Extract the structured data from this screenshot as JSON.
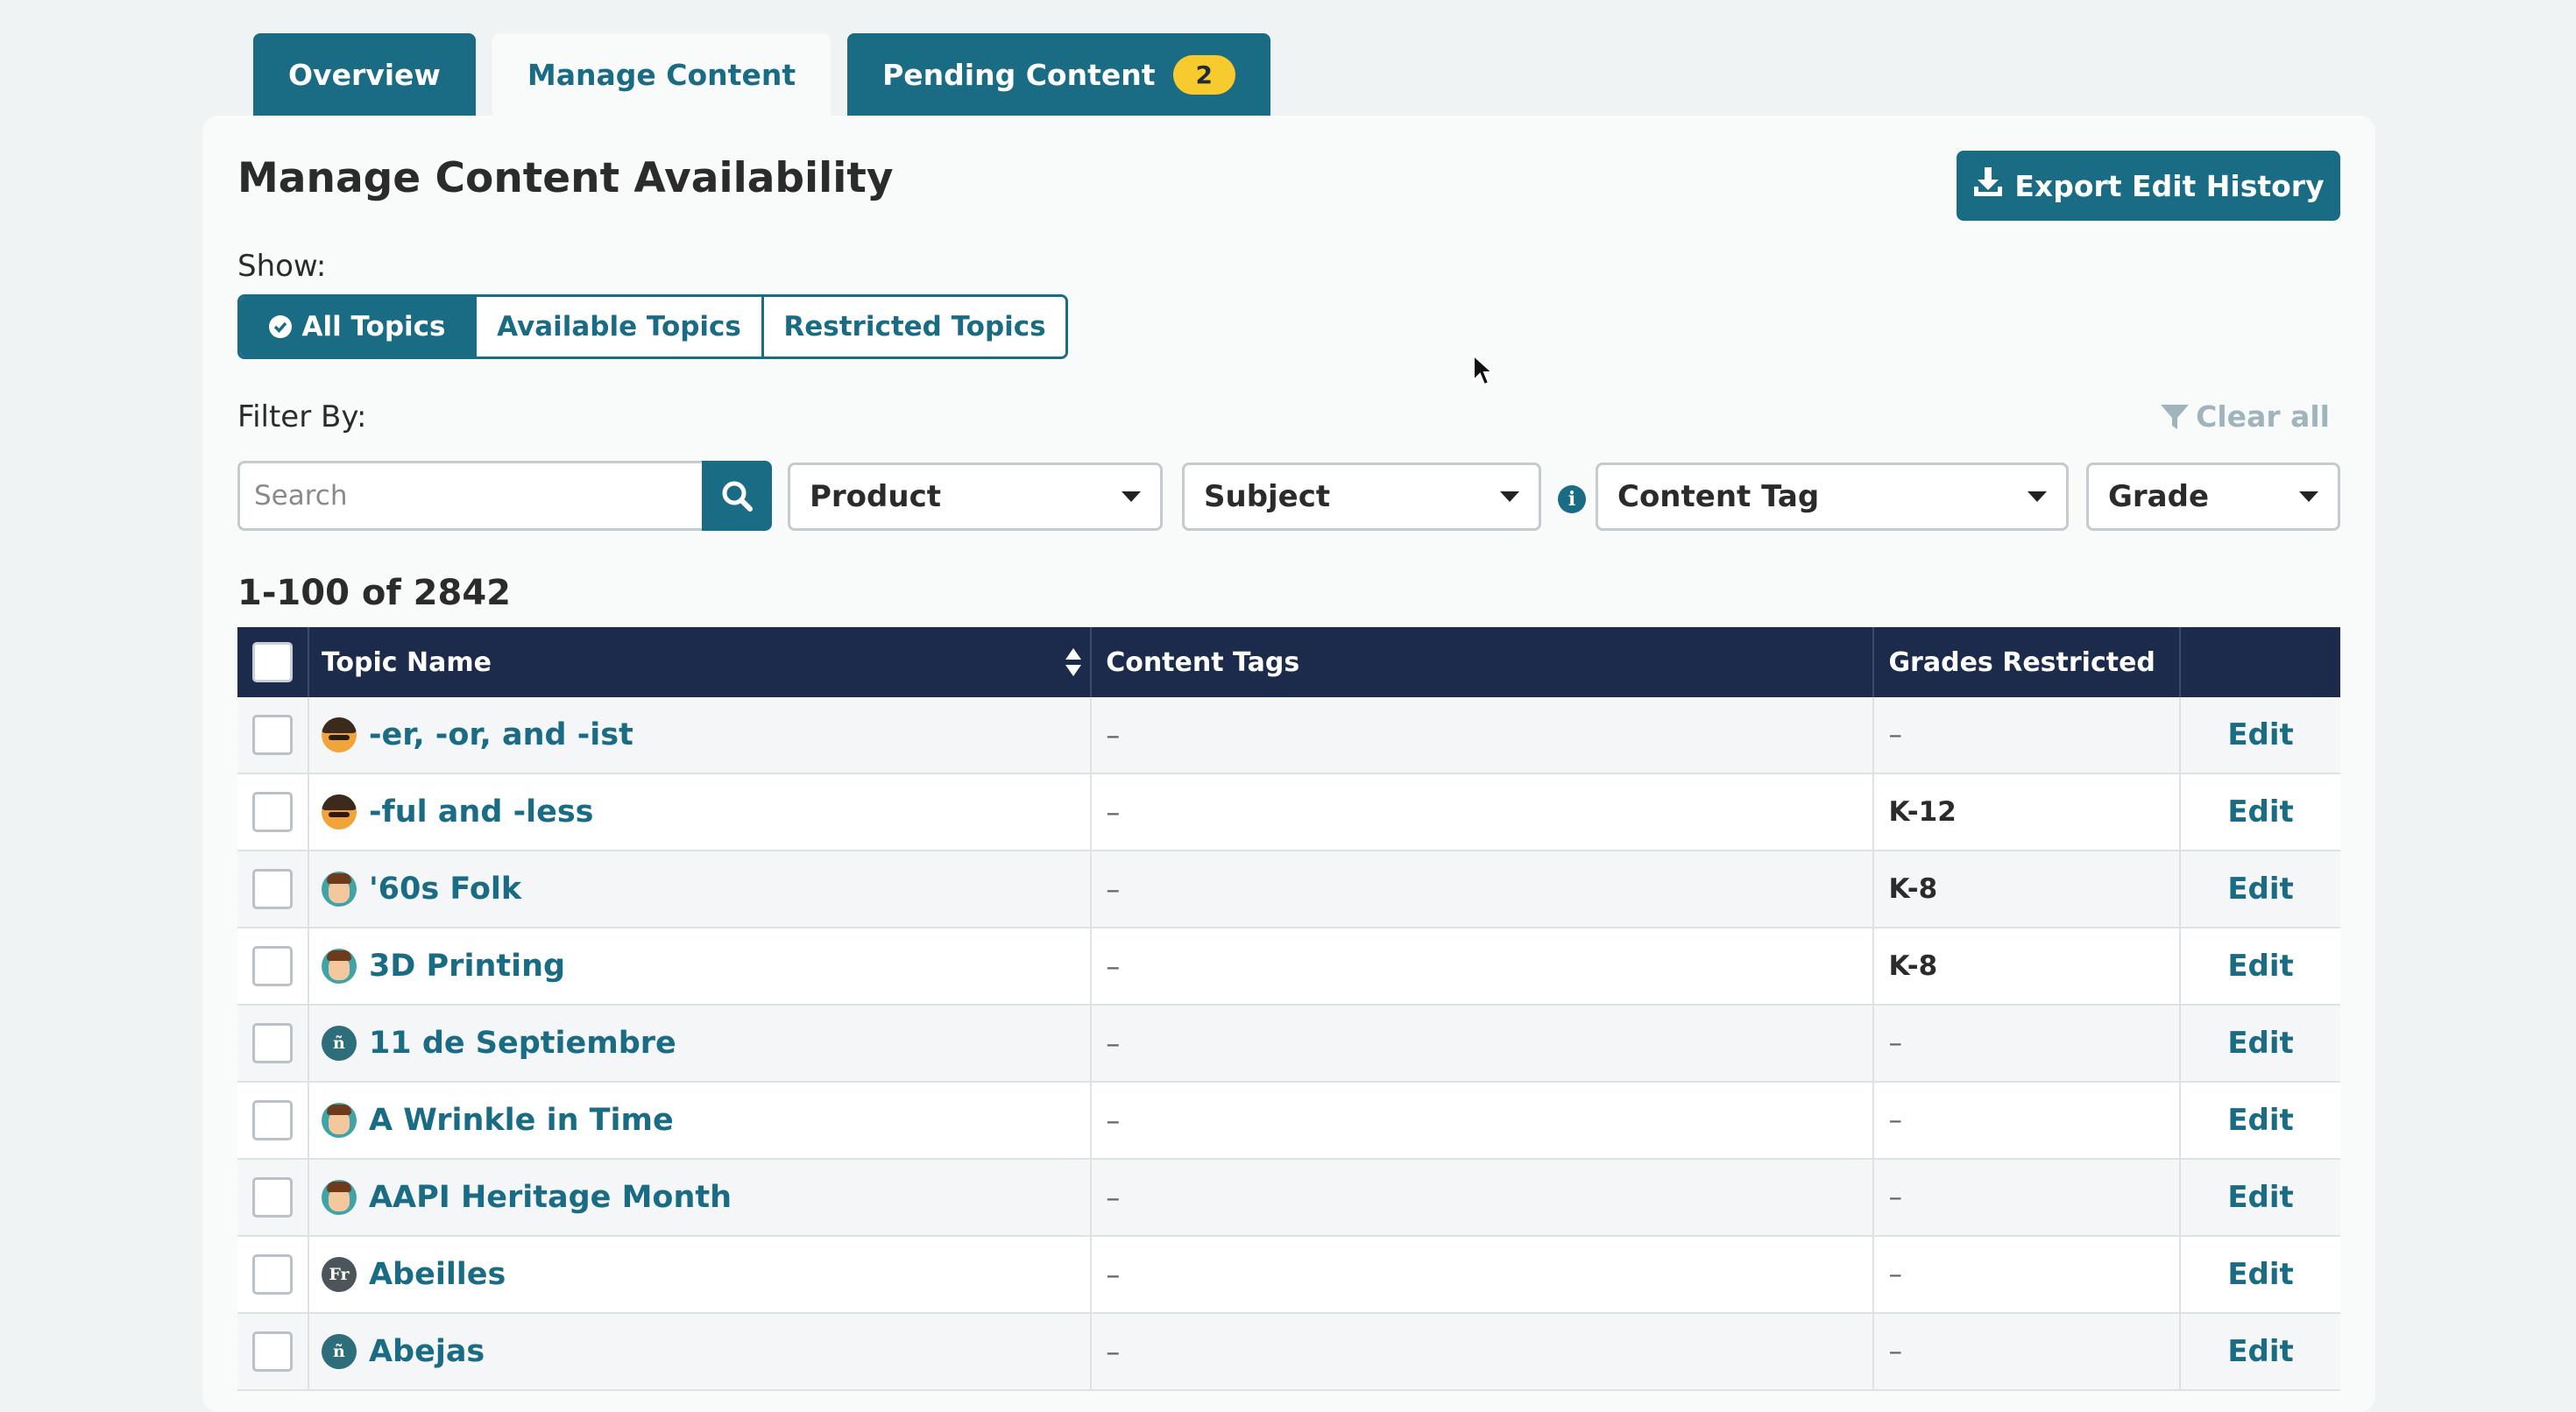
{
  "tabs": [
    {
      "label": "Overview"
    },
    {
      "label": "Manage Content"
    },
    {
      "label": "Pending Content",
      "badge": "2"
    }
  ],
  "page": {
    "title": "Manage Content Availability",
    "export_label": "Export Edit History",
    "show_label": "Show:",
    "show_options": [
      "All Topics",
      "Available Topics",
      "Restricted Topics"
    ],
    "filter_label": "Filter By:",
    "clear_all_label": "Clear all",
    "search_placeholder": "Search",
    "filters": [
      "Product",
      "Subject",
      "Content Tag",
      "Grade"
    ],
    "result_count": "1-100 of 2842"
  },
  "table": {
    "headers": {
      "topic": "Topic Name",
      "tags": "Content Tags",
      "grades": "Grades Restricted"
    },
    "rows": [
      {
        "icon": "kid",
        "name": "-er, -or, and -ist",
        "tags": "–",
        "grades": "–",
        "action": "Edit"
      },
      {
        "icon": "kid",
        "name": "-ful and -less",
        "tags": "–",
        "grades": "K-12",
        "action": "Edit"
      },
      {
        "icon": "boy",
        "name": "'60s Folk",
        "tags": "–",
        "grades": "K-8",
        "action": "Edit"
      },
      {
        "icon": "boy",
        "name": "3D Printing",
        "tags": "–",
        "grades": "K-8",
        "action": "Edit"
      },
      {
        "icon": "es",
        "name": "11 de Septiembre",
        "tags": "–",
        "grades": "–",
        "action": "Edit"
      },
      {
        "icon": "boy",
        "name": "A Wrinkle in Time",
        "tags": "–",
        "grades": "–",
        "action": "Edit"
      },
      {
        "icon": "boy",
        "name": "AAPI Heritage Month",
        "tags": "–",
        "grades": "–",
        "action": "Edit"
      },
      {
        "icon": "fr",
        "name": "Abeilles",
        "tags": "–",
        "grades": "–",
        "action": "Edit"
      },
      {
        "icon": "es",
        "name": "Abejas",
        "tags": "–",
        "grades": "–",
        "action": "Edit"
      }
    ]
  },
  "colors": {
    "primary": "#1a6b84",
    "header": "#1c2b4b",
    "badge": "#f7cb2e"
  }
}
